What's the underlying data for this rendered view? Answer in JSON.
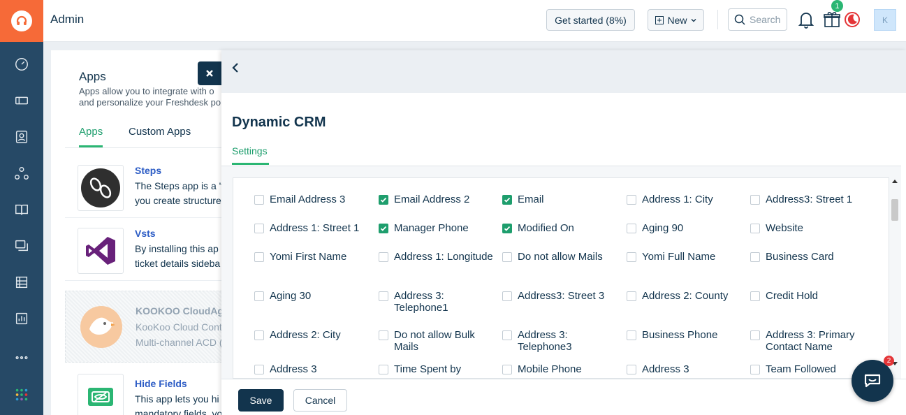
{
  "header": {
    "title": "Admin",
    "get_started_label": "Get started (8%)",
    "new_label": "New",
    "search_placeholder": "Search",
    "gift_count": "1",
    "avatar_initial": "K"
  },
  "apps_panel": {
    "title": "Apps",
    "description_line1": "Apps allow you to integrate with o",
    "description_line2": "and personalize your Freshdesk po",
    "tabs": [
      "Apps",
      "Custom Apps"
    ],
    "apps": [
      {
        "name": "Steps",
        "line1": "The Steps app is a 't",
        "line2": "you create structure"
      },
      {
        "name": "Vsts",
        "line1": "By installing this ap",
        "line2": "ticket details sideba"
      },
      {
        "name": "KOOKOO CloudAge",
        "line1": "KooKoo Cloud Cont",
        "line2": "Multi-channel ACD ("
      },
      {
        "name": "Hide Fields",
        "line1": "This app lets you hi",
        "line2": "mandatory fields, yo"
      }
    ]
  },
  "modal": {
    "title": "Dynamic CRM",
    "tab": "Settings",
    "save_label": "Save",
    "cancel_label": "Cancel",
    "fields": [
      [
        {
          "label": "Email Address 3",
          "checked": false
        },
        {
          "label": "Email Address 2",
          "checked": true
        },
        {
          "label": "Email",
          "checked": true
        },
        {
          "label": "Address 1: City",
          "checked": false
        },
        {
          "label": "Address3: Street 1",
          "checked": false
        }
      ],
      [
        {
          "label": "Address 1: Street 1",
          "checked": false
        },
        {
          "label": "Manager Phone",
          "checked": true
        },
        {
          "label": "Modified On",
          "checked": true
        },
        {
          "label": "Aging 90",
          "checked": false
        },
        {
          "label": "Website",
          "checked": false
        }
      ],
      [
        {
          "label": "Yomi First Name",
          "checked": false
        },
        {
          "label": "Address 1: Longitude",
          "checked": false
        },
        {
          "label": "Do not allow Mails",
          "checked": false
        },
        {
          "label": "Yomi Full Name",
          "checked": false
        },
        {
          "label": "Business Card",
          "checked": false
        }
      ],
      [
        {
          "label": "Aging 30",
          "checked": false
        },
        {
          "label": "Address 3: Telephone1",
          "checked": false
        },
        {
          "label": "Address3: Street 3",
          "checked": false
        },
        {
          "label": "Address 2: County",
          "checked": false
        },
        {
          "label": "Credit Hold",
          "checked": false
        }
      ],
      [
        {
          "label": "Address 2: City",
          "checked": false
        },
        {
          "label": "Do not allow Bulk Mails",
          "checked": false
        },
        {
          "label": "Address 3: Telephone3",
          "checked": false
        },
        {
          "label": "Business Phone",
          "checked": false
        },
        {
          "label": "Address 3: Primary Contact Name",
          "checked": false
        }
      ],
      [
        {
          "label": "Address 3",
          "checked": false
        },
        {
          "label": "Time Spent by",
          "checked": false
        },
        {
          "label": "Mobile Phone",
          "checked": false
        },
        {
          "label": "Address 3",
          "checked": false
        },
        {
          "label": "Team Followed",
          "checked": false
        }
      ]
    ]
  },
  "chat": {
    "badge": "2"
  }
}
